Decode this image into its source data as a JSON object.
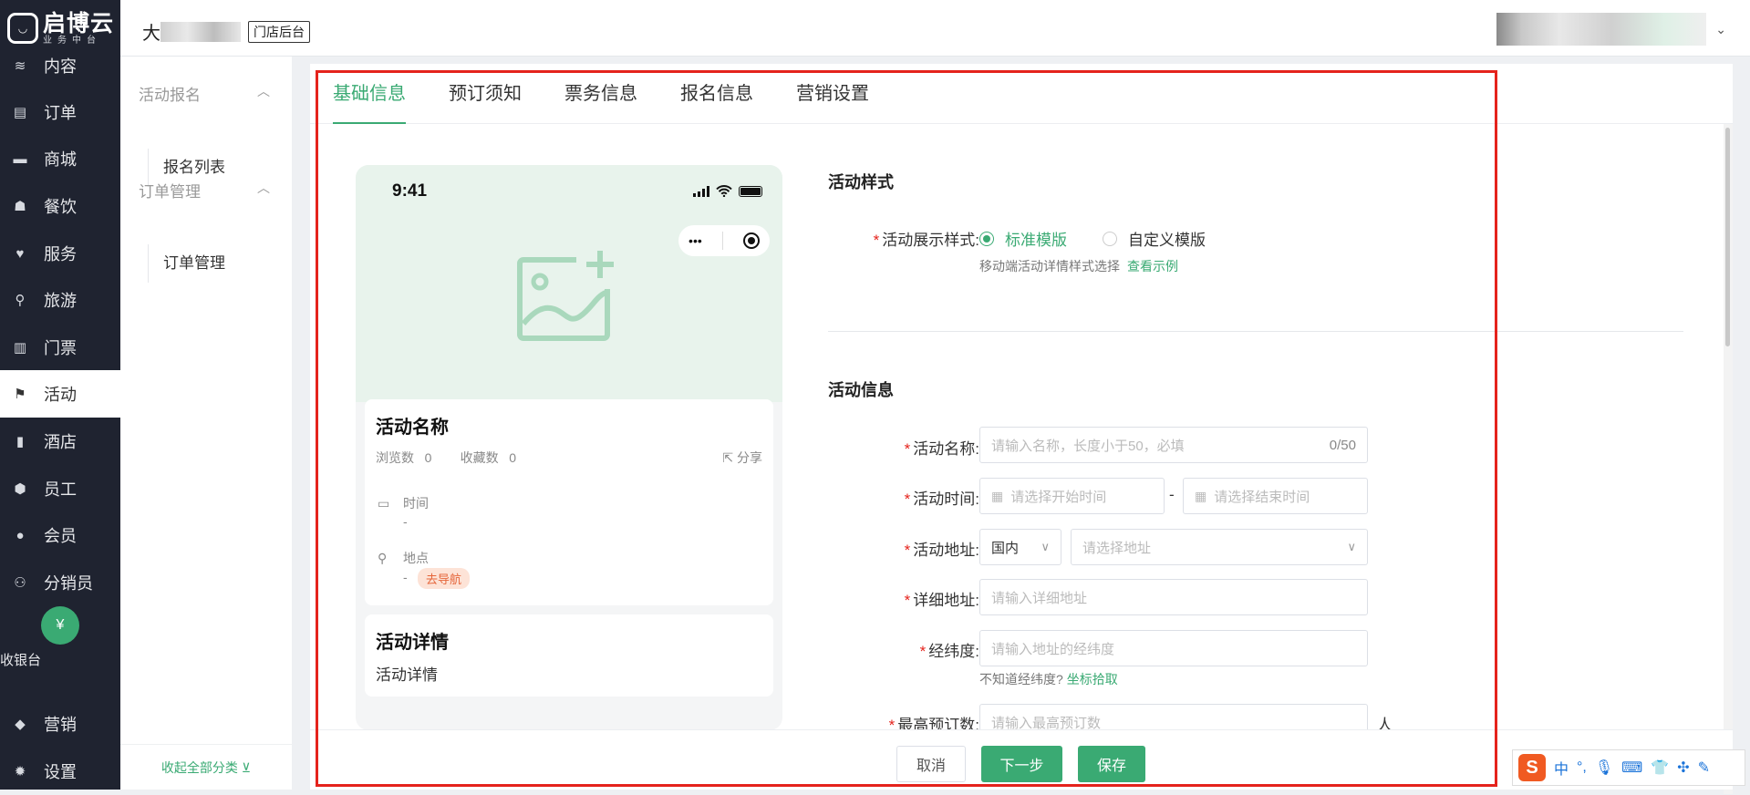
{
  "brand": {
    "logo_text": "启博云",
    "logo_sub": "业务中台",
    "mark": "◡"
  },
  "topbar": {
    "store_prefix": "大",
    "store_tag": "门店后台",
    "user_chevron": "⌄"
  },
  "sidebar": {
    "items": [
      {
        "label": "内容",
        "icon": "layers-icon",
        "glyph": "≋"
      },
      {
        "label": "订单",
        "icon": "order-icon",
        "glyph": "▤"
      },
      {
        "label": "商城",
        "icon": "store-icon",
        "glyph": "▬"
      },
      {
        "label": "餐饮",
        "icon": "chef-hat-icon",
        "glyph": "☗"
      },
      {
        "label": "服务",
        "icon": "heart-icon",
        "glyph": "♥"
      },
      {
        "label": "旅游",
        "icon": "map-pin-icon",
        "glyph": "⚲"
      },
      {
        "label": "门票",
        "icon": "ticket-icon",
        "glyph": "▥"
      },
      {
        "label": "活动",
        "icon": "flag-icon",
        "glyph": "⚑"
      },
      {
        "label": "酒店",
        "icon": "hotel-icon",
        "glyph": "▮"
      },
      {
        "label": "员工",
        "icon": "staff-icon",
        "glyph": "⬢"
      },
      {
        "label": "会员",
        "icon": "member-icon",
        "glyph": "●"
      },
      {
        "label": "分销员",
        "icon": "distribution-icon",
        "glyph": "⚇"
      },
      {
        "label": "营销",
        "icon": "tag-icon",
        "glyph": "◆"
      },
      {
        "label": "设置",
        "icon": "settings-icon",
        "glyph": "✹"
      }
    ],
    "active": "活动",
    "cashier": {
      "label": "收银台",
      "glyph": "¥"
    }
  },
  "submenu": {
    "groups": [
      {
        "title": "活动报名",
        "items": [
          "报名列表"
        ]
      },
      {
        "title": "订单管理",
        "items": [
          "订单管理"
        ]
      }
    ],
    "collapse_label": "收起全部分类 ⊻",
    "arrow": "︿"
  },
  "tabs": [
    "基础信息",
    "预订须知",
    "票务信息",
    "报名信息",
    "营销设置"
  ],
  "active_tab": "基础信息",
  "preview": {
    "time": "9:41",
    "capsule_dots": "•••",
    "name": "活动名称",
    "views_label": "浏览数",
    "views": "0",
    "favs_label": "收藏数",
    "favs": "0",
    "share": "分享",
    "share_icon": "⇱",
    "time_label": "时间",
    "time_value": "-",
    "time_icon": "▭",
    "place_label": "地点",
    "place_value": "-",
    "place_icon": "⚲",
    "navigate": "去导航",
    "detail_title": "活动详情",
    "detail_text": "活动详情"
  },
  "form": {
    "style_section": "活动样式",
    "style_label": "活动展示样式:",
    "style_options": [
      "标准模版",
      "自定义模版"
    ],
    "style_selected": "标准模版",
    "style_hint": "移动端活动详情样式选择",
    "style_hint_link": "查看示例",
    "info_section": "活动信息",
    "name_label": "活动名称:",
    "name_placeholder": "请输入名称，长度小于50，必填",
    "name_count": "0/50",
    "time_label": "活动时间:",
    "start_placeholder": "请选择开始时间",
    "end_placeholder": "请选择结束时间",
    "range_sep": "-",
    "cal_icon": "▦",
    "addr_label": "活动地址:",
    "region_value": "国内",
    "addr_placeholder": "请选择地址",
    "select_arrow": "∨",
    "detail_label": "详细地址:",
    "detail_placeholder": "请输入详细地址",
    "latlng_label": "经纬度:",
    "latlng_placeholder": "请输入地址的经纬度",
    "latlng_hint": "不知道经纬度?",
    "latlng_link": "坐标拾取",
    "max_label": "最高预订数:",
    "max_placeholder": "请输入最高预订数",
    "max_unit": "人"
  },
  "footer": {
    "cancel": "取消",
    "next": "下一步",
    "save": "保存"
  },
  "ime": {
    "logo": "S",
    "items": [
      "中",
      "°,",
      "🎙",
      "⌨",
      "👕",
      "✣",
      "✎"
    ]
  },
  "colors": {
    "accent": "#3aaa73",
    "sidebar": "#1f2330",
    "highlight": "#e5231c",
    "nav_pill": "#e5653a"
  }
}
